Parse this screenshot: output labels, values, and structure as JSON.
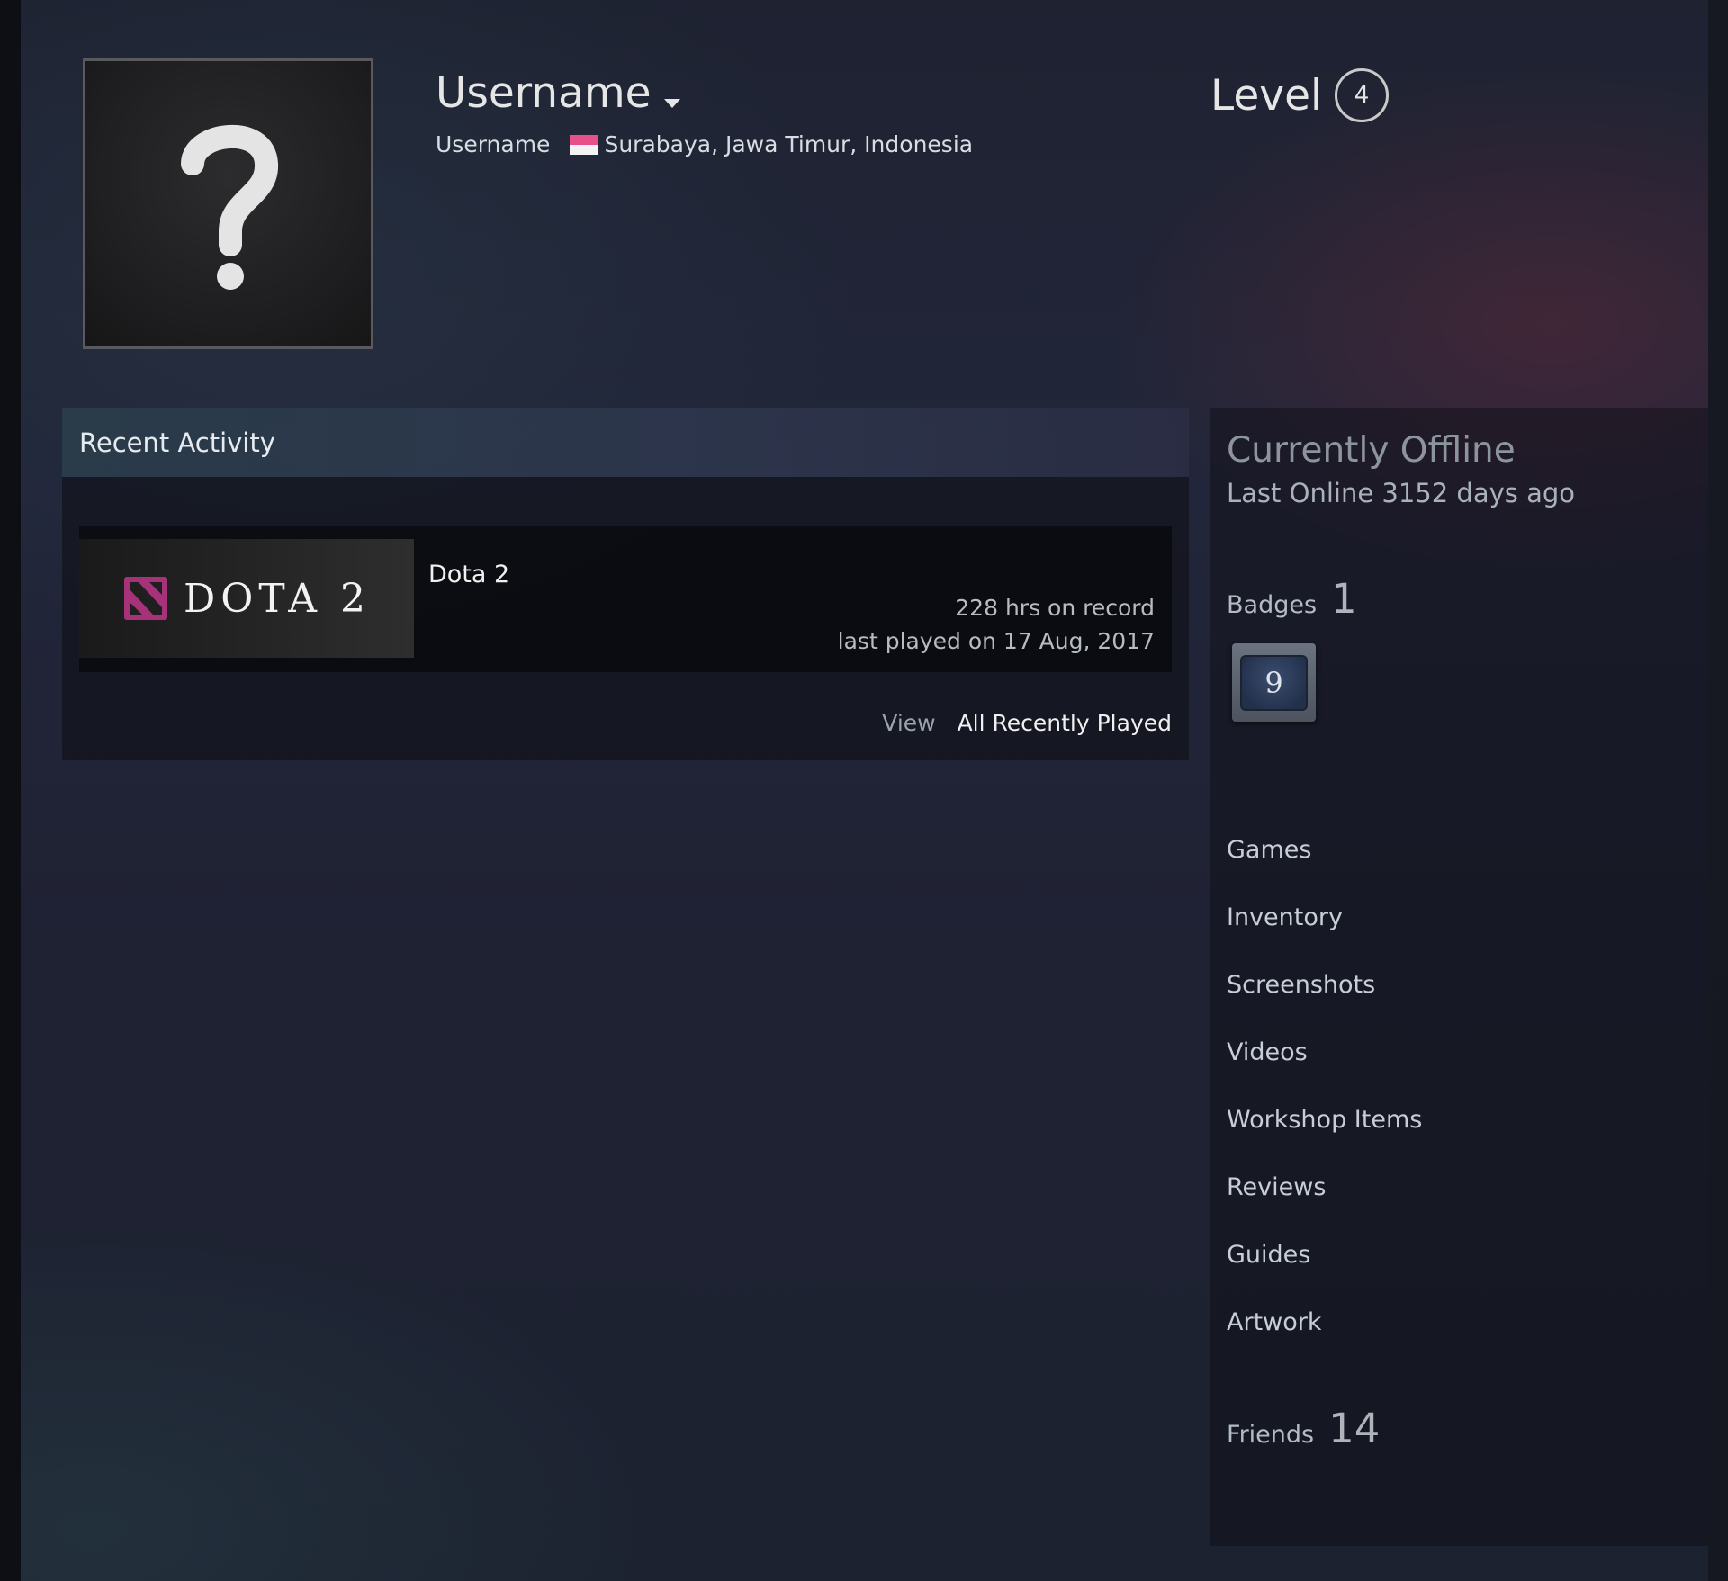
{
  "profile": {
    "persona_name": "Username",
    "real_name": "Username",
    "location": "Surabaya, Jawa Timur, Indonesia",
    "level_label": "Level",
    "level": "4"
  },
  "recent_activity": {
    "title": "Recent Activity",
    "games": [
      {
        "name": "Dota 2",
        "logo_text": "DOTA 2",
        "hours": "228 hrs on record",
        "last_played": "last played on 17 Aug, 2017"
      }
    ],
    "view_label": "View",
    "view_link": "All Recently Played"
  },
  "sidebar": {
    "status": "Currently Offline",
    "last_online": "Last Online 3152 days ago",
    "badges_label": "Badges",
    "badges_count": "1",
    "badge_icon_text": "9",
    "links": [
      {
        "label": "Games"
      },
      {
        "label": "Inventory"
      },
      {
        "label": "Screenshots"
      },
      {
        "label": "Videos"
      },
      {
        "label": "Workshop Items"
      },
      {
        "label": "Reviews"
      },
      {
        "label": "Guides"
      },
      {
        "label": "Artwork"
      }
    ],
    "friends_label": "Friends",
    "friends_count": "14"
  },
  "colors": {
    "flag_top": "#e8508a",
    "flag_bottom": "#f3f3f3",
    "dota_logo": "#a8327a"
  }
}
